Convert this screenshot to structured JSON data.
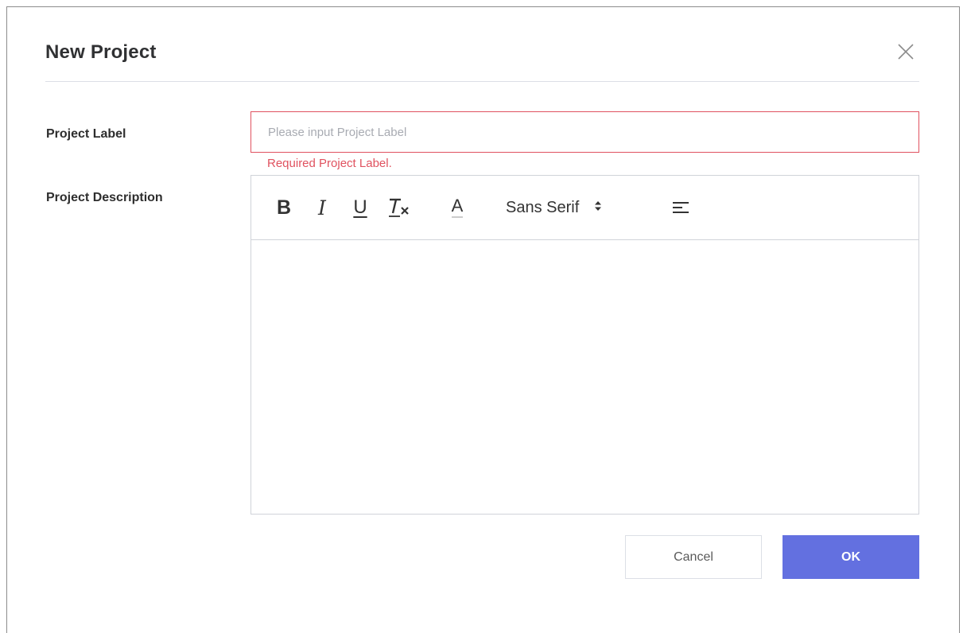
{
  "dialog": {
    "title": "New Project",
    "close_icon": "close-icon"
  },
  "form": {
    "project_label": {
      "label": "Project Label",
      "value": "",
      "placeholder": "Please input Project Label",
      "error": "Required Project Label."
    },
    "project_description": {
      "label": "Project Description",
      "toolbar": {
        "bold_label": "B",
        "italic_label": "I",
        "underline_label": "U",
        "clean_icon": "clear-format-icon",
        "color_label": "A",
        "font_value": "Sans Serif",
        "align_icon": "align-left-icon"
      },
      "content": ""
    }
  },
  "actions": {
    "cancel_label": "Cancel",
    "ok_label": "OK"
  },
  "colors": {
    "primary": "#6370e0",
    "error": "#e0525f",
    "border": "#dcdfe6"
  }
}
